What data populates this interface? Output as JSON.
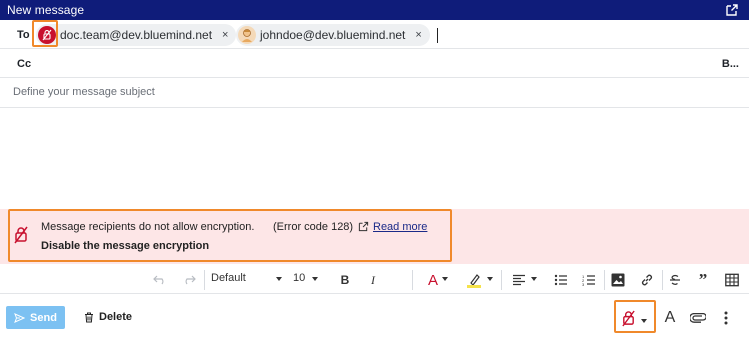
{
  "window": {
    "title": "New message"
  },
  "recipients": {
    "to_label": "To",
    "cc_label": "Cc",
    "bcc_label": "B...",
    "to": [
      {
        "address": "doc.team@dev.bluemind.net",
        "remove": "×"
      },
      {
        "address": "johndoe@dev.bluemind.net",
        "remove": "×"
      }
    ]
  },
  "subject": {
    "placeholder": "Define your message subject"
  },
  "alert": {
    "message": "Message recipients do not allow encryption.",
    "code": "(Error code 128)",
    "link": "Read more",
    "action": "Disable the message encryption"
  },
  "toolbar": {
    "font": "Default",
    "size": "10",
    "bold": "B",
    "italic": "I",
    "color_letter": "A",
    "quote": "”"
  },
  "actions": {
    "send": "Send",
    "delete": "Delete",
    "text_format": "A"
  },
  "colors": {
    "titlebar": "#0f1c7a",
    "alert_bg": "#fde6e7",
    "encryption_red": "#c8102e",
    "send_bg": "#7cc1f2",
    "highlight": "#f0892b"
  }
}
